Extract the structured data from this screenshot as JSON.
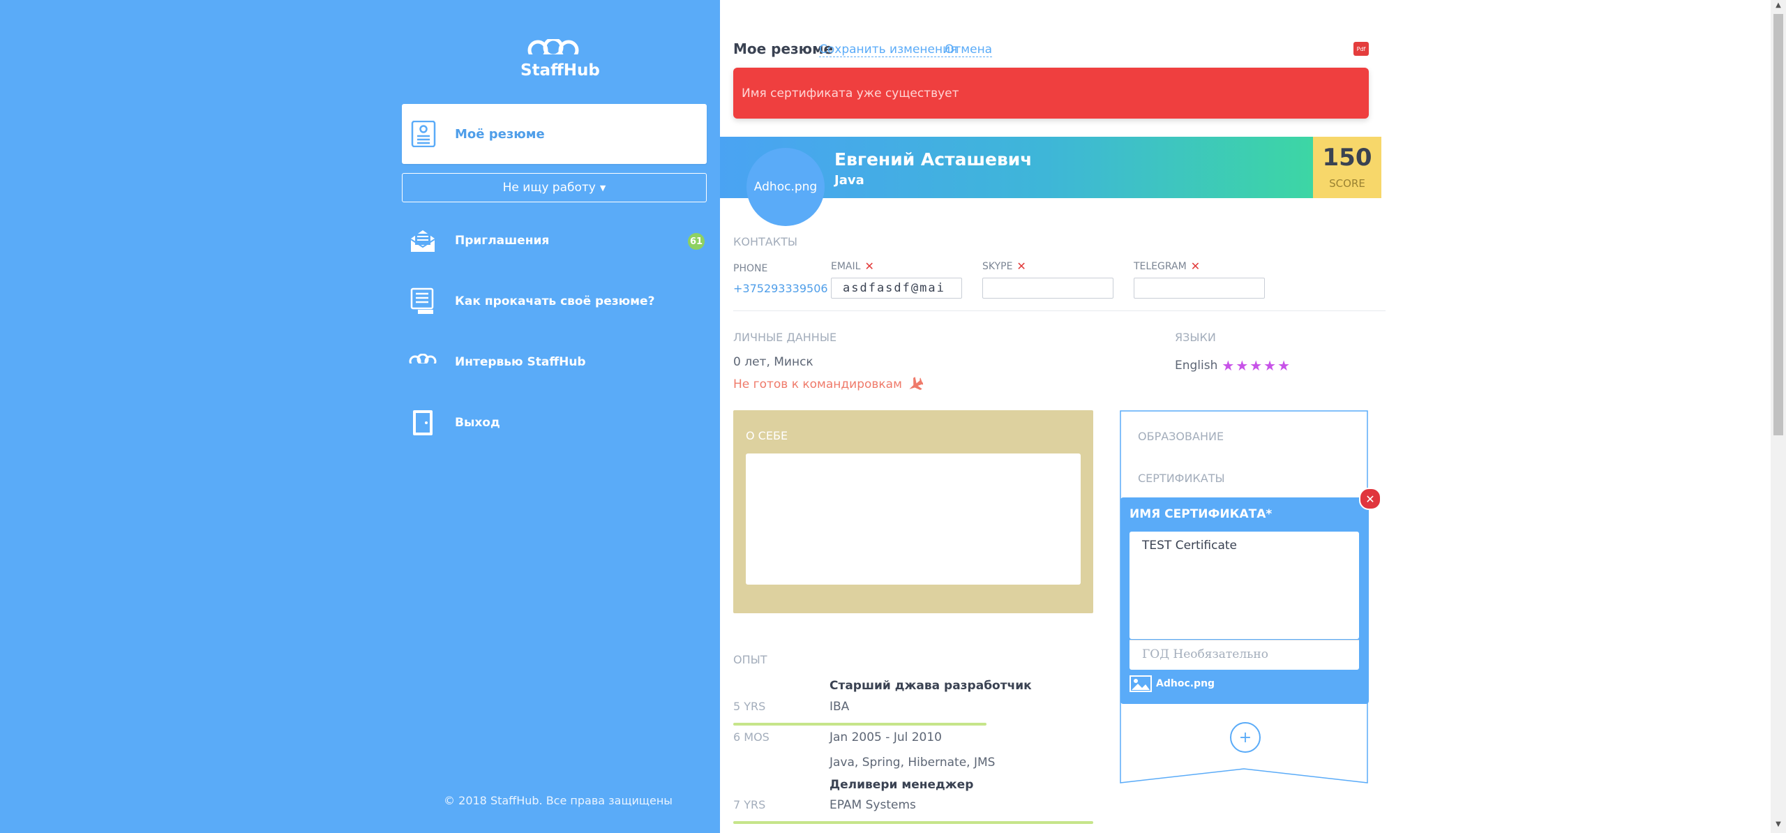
{
  "sidebar": {
    "logo_text": "StaffHub",
    "resume_label": "Моё резюме",
    "status_label": "Не ищу работу",
    "items": [
      {
        "label": "Приглашения",
        "badge": "61",
        "icon": "envelope-icon"
      },
      {
        "label": "Как прокачать своё резюме?",
        "icon": "list-icon"
      },
      {
        "label": "Интервью StaffHub",
        "icon": "staffhub-logo-icon"
      },
      {
        "label": "Выход",
        "icon": "door-icon"
      }
    ],
    "copyright": "© 2018 StaffHub. Все права защищены"
  },
  "header": {
    "title": "Мое резюме",
    "save_link": "Сохранить изменения",
    "cancel_link": "Отмена",
    "pdf_label": "Pdf"
  },
  "alert": {
    "message": "Имя сертификата уже существует"
  },
  "profile": {
    "avatar_label": "Adhoc.png",
    "name": "Евгений Асташевич",
    "role": "Java",
    "score": "150",
    "score_label": "SCORE"
  },
  "contacts": {
    "section_label": "КОНТАКТЫ",
    "phone_label": "PHONE",
    "phone_value": "+375293339506",
    "email_label": "EMAIL",
    "email_value": "asdfasdf@mai",
    "skype_label": "SKYPE",
    "skype_value": "",
    "telegram_label": "TELEGRAM",
    "telegram_value": ""
  },
  "personal": {
    "section_label": "ЛИЧНЫЕ ДАННЫЕ",
    "age_city": "0 лет, Минск",
    "travel": "Не готов к командировкам"
  },
  "languages": {
    "section_label": "ЯЗЫКИ",
    "items": [
      {
        "name": "English",
        "stars": "★★★★★",
        "rating": 5
      }
    ]
  },
  "about": {
    "title": "О СЕБЕ",
    "text": ""
  },
  "experience": {
    "section_label": "ОПЫТ",
    "jobs": [
      {
        "title": "Старший джава разработчик",
        "company": "IBA",
        "period": "Jan 2005 - Jul 2010",
        "skills": "Java, Spring, Hibernate, JMS",
        "years": "5 YRS",
        "months": "6 MOS"
      },
      {
        "title": "Деливери менеджер",
        "company": "EPAM Systems",
        "years": "7 YRS"
      }
    ]
  },
  "education": {
    "edu_label": "ОБРАЗОВАНИЕ",
    "cert_label": "СЕРТИФИКАТЫ",
    "cert_form": {
      "name_label": "ИМЯ СЕРТИФИКАТА*",
      "name_value": "TEST Certificate",
      "year_placeholder": "ГОД Необязательно",
      "image_label": "Adhoc.png"
    },
    "add_label": "+"
  }
}
